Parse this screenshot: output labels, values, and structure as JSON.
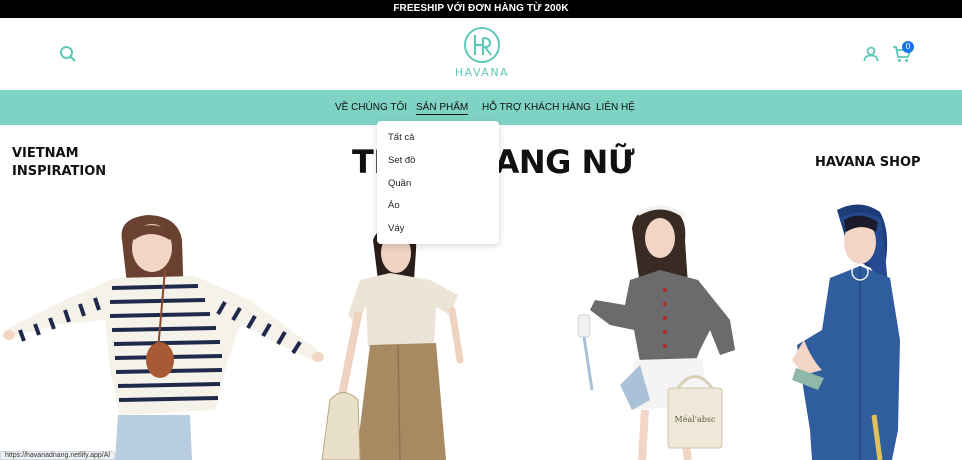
{
  "topbar": {
    "text": "FREESHIP VỚI ĐƠN HÀNG TỪ 200K"
  },
  "header": {
    "logo_text": "HAVANA",
    "cart_count": "0",
    "icons": {
      "search": "search-icon",
      "user": "user-icon",
      "cart": "cart-icon"
    },
    "brand_color": "#5fc9b7"
  },
  "nav": {
    "background": "#7fd3c4",
    "items": [
      {
        "label": "VỀ CHÚNG TÔI"
      },
      {
        "label": "SẢN PHẨM"
      },
      {
        "label": "HỖ TRỢ KHÁCH HÀNG"
      },
      {
        "label": "LIÊN HỆ"
      }
    ]
  },
  "dropdown": {
    "items": [
      {
        "label": "Tất cả"
      },
      {
        "label": "Set đồ"
      },
      {
        "label": "Quần"
      },
      {
        "label": "Áo"
      },
      {
        "label": "Váy"
      }
    ]
  },
  "hero": {
    "left_line1": "VIETNAM",
    "left_line2": "INSPIRATION",
    "title": "THỜI TRANG NỮ",
    "right": "HAVANA SHOP",
    "tote_text": "Méal'absc"
  },
  "status_bar": {
    "url": "https://havanadnang.netlify.app/Al"
  }
}
